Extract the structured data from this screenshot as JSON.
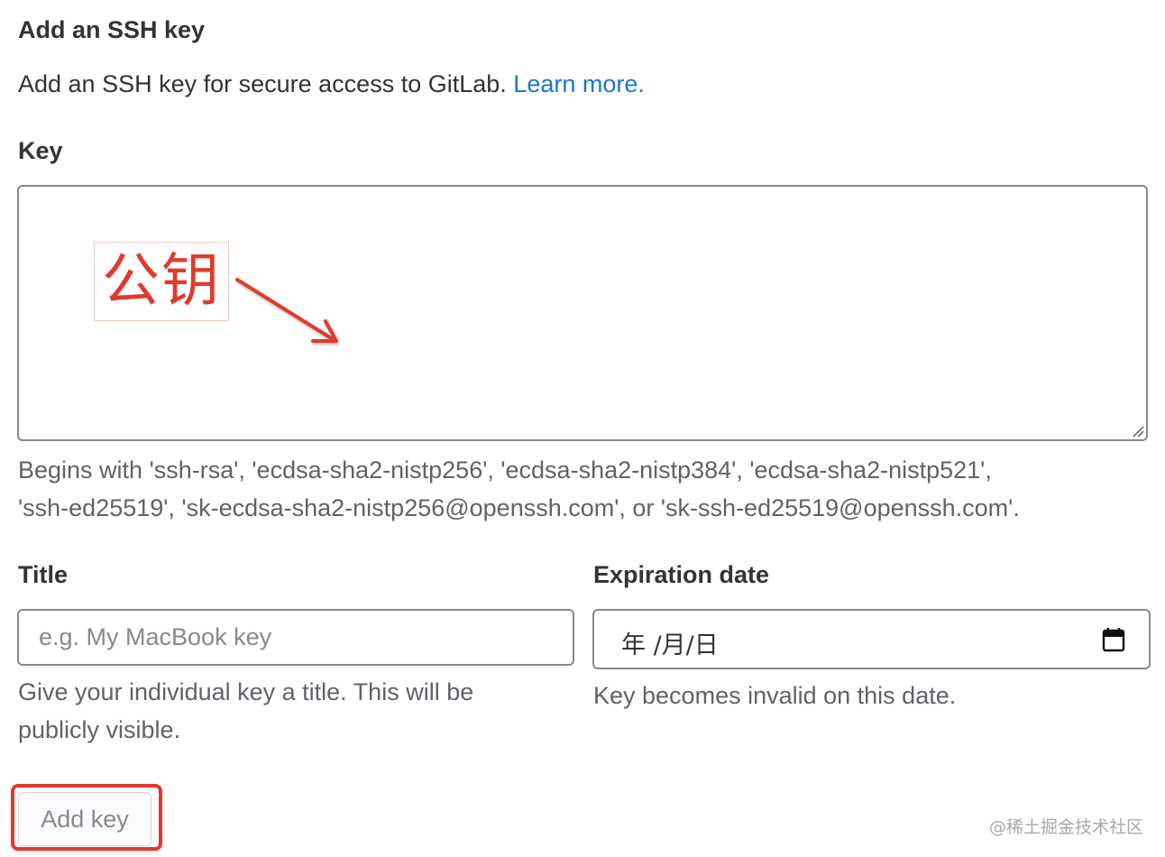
{
  "section": {
    "heading": "Add an SSH key",
    "intro_text": "Add an SSH key for secure access to GitLab.",
    "learn_more_link": "Learn more."
  },
  "key_field": {
    "label": "Key",
    "value": "",
    "annotation_text": "公钥",
    "help_line1": "Begins with 'ssh-rsa', 'ecdsa-sha2-nistp256', 'ecdsa-sha2-nistp384', 'ecdsa-sha2-nistp521',",
    "help_line2": "'ssh-ed25519', 'sk-ecdsa-sha2-nistp256@openssh.com', or 'sk-ssh-ed25519@openssh.com'."
  },
  "title_field": {
    "label": "Title",
    "placeholder": "e.g. My MacBook key",
    "value": "",
    "help_line1": "Give your individual key a title. This will be",
    "help_line2": "publicly visible."
  },
  "expiration_field": {
    "label": "Expiration date",
    "display_value": "年 /月/日",
    "icon": "calendar-icon",
    "help": "Key becomes invalid on this date."
  },
  "actions": {
    "add_key_label": "Add key",
    "add_key_disabled": true
  },
  "watermark": "@稀土掘金技术社区",
  "colors": {
    "link": "#1f75cb",
    "annotation_red": "#e03a2f",
    "text": "#333238",
    "muted": "#626168",
    "border": "#89888d"
  }
}
